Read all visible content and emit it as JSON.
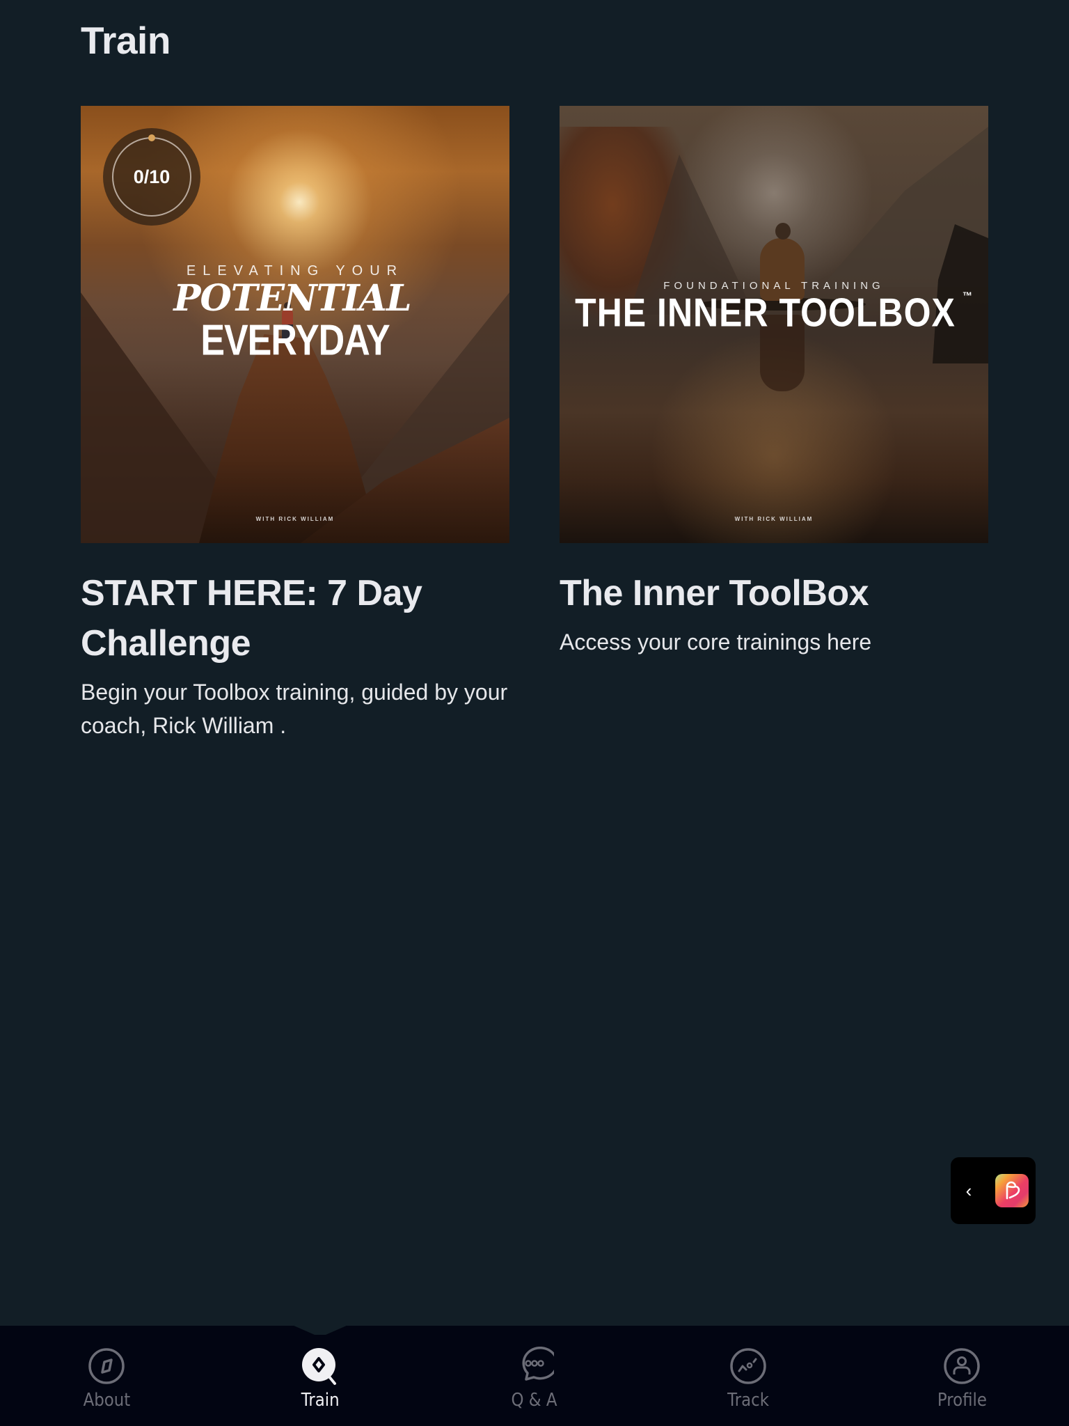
{
  "page": {
    "title": "Train"
  },
  "cards": [
    {
      "cover": {
        "subtitle": "ELEVATING YOUR",
        "title_script": "POTENTIAL",
        "title_block": "EVERYDAY",
        "credit": "WITH RICK WILLIAM"
      },
      "progress": {
        "completed": 0,
        "total": 10,
        "label": "0/10"
      },
      "title": "START HERE: 7 Day Challenge",
      "description": "Begin your Toolbox training, guided by your coach, Rick William ."
    },
    {
      "cover": {
        "subtitle": "FOUNDATIONAL TRAINING",
        "title": "THE INNER TOOLBOX",
        "trademark": "™",
        "credit": "WITH RICK WILLIAM"
      },
      "title": "The Inner ToolBox",
      "description": "Access your core trainings here"
    }
  ],
  "floating_widget": {
    "collapse_icon": "‹",
    "app_icon": "app-logo-icon"
  },
  "tabbar": {
    "active": "Train",
    "items": [
      {
        "label": "About",
        "icon": "compass-icon"
      },
      {
        "label": "Train",
        "icon": "train-search-icon"
      },
      {
        "label": "Q & A",
        "icon": "chat-bubble-icon"
      },
      {
        "label": "Track",
        "icon": "chart-trend-icon"
      },
      {
        "label": "Profile",
        "icon": "user-icon"
      }
    ]
  },
  "colors": {
    "background": "#121e26",
    "tabbar": "#020512",
    "text": "#e9eaee",
    "tab_inactive": "#6c6d77",
    "progress_dot": "#d9a35b"
  }
}
